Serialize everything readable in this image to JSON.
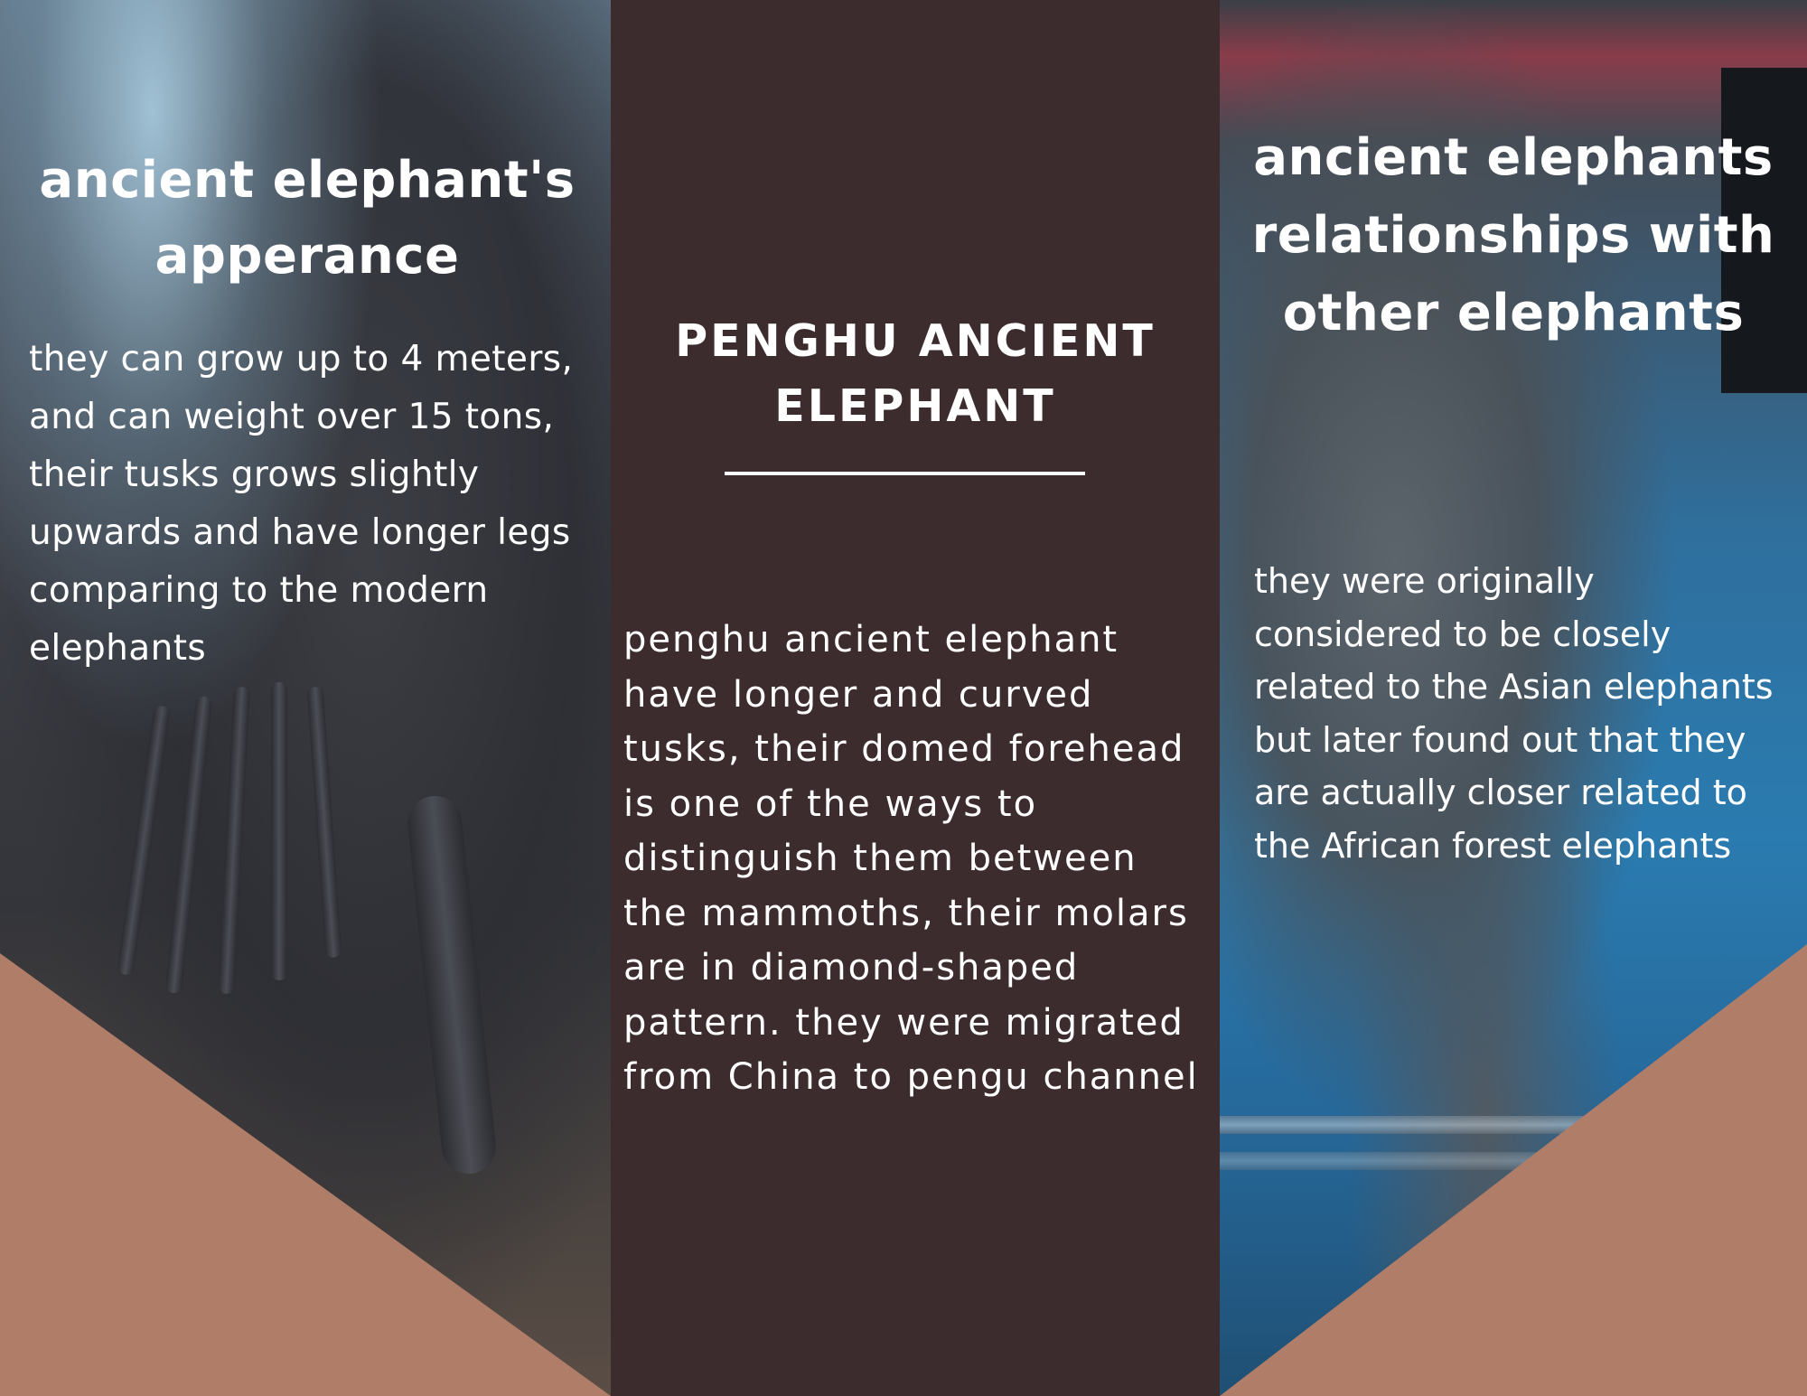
{
  "left_panel": {
    "heading": "ancient elephant's apperance",
    "body": "they can grow up to 4 meters, and can weight over 15 tons, their tusks grows slightly upwards and have longer legs comparing to the modern elephants"
  },
  "middle_panel": {
    "title": "PENGHU ANCIENT ELEPHANT",
    "body": "penghu ancient elephant have longer and curved tusks, their domed forehead is one of the ways to distinguish them between the mammoths, their molars are in diamond-shaped pattern. they were migrated from China to pengu channel"
  },
  "right_panel": {
    "heading": "ancient elephants relationships with other elephants",
    "body": "they were originally considered to be closely related to the Asian elephants but later found out that they are actually closer related to the African forest elephants"
  },
  "colors": {
    "accent_triangle": "#b07d68",
    "middle_background": "#3d2c2d",
    "text": "#ffffff"
  }
}
